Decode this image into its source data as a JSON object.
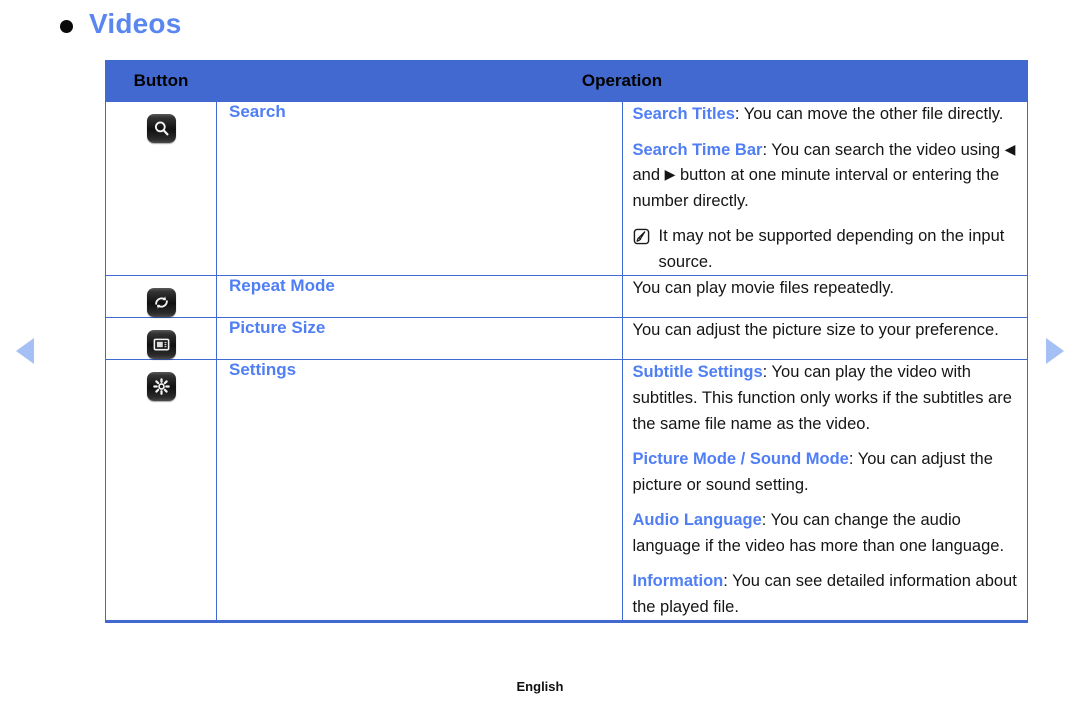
{
  "heading": {
    "bullet": "bullet-point",
    "title": "Videos"
  },
  "nav": {
    "prev_label": "previous-page",
    "next_label": "next-page"
  },
  "table": {
    "headers": {
      "button": "Button",
      "operation": "Operation"
    },
    "rows": [
      {
        "icon": "search-icon",
        "name": "Search",
        "blocks": [
          {
            "kind": "text",
            "term": "Search Titles",
            "rest": ": You can move the other file directly."
          },
          {
            "kind": "text",
            "term": "Search Time Bar",
            "rest_a": ": You can search the video using ",
            "glyph_left": "◀",
            "mid": " and ",
            "glyph_right": "▶",
            "rest_b": " button at one minute interval or entering the number directly."
          },
          {
            "kind": "note",
            "note": "It may not be supported depending on the input source."
          }
        ]
      },
      {
        "icon": "repeat-icon",
        "name": "Repeat Mode",
        "blocks": [
          {
            "kind": "plain",
            "text": "You can play movie files repeatedly."
          }
        ]
      },
      {
        "icon": "picture-size-icon",
        "name": "Picture Size",
        "blocks": [
          {
            "kind": "plain",
            "text": "You can adjust the picture size to your preference."
          }
        ]
      },
      {
        "icon": "settings-gear-icon",
        "name": "Settings",
        "blocks": [
          {
            "kind": "text",
            "term": "Subtitle Settings",
            "rest": ": You can play the video with subtitles. This function only works if the subtitles are the same file name as the video."
          },
          {
            "kind": "text",
            "term": "Picture Mode / Sound Mode",
            "rest": ": You can adjust the picture or sound setting."
          },
          {
            "kind": "text",
            "term": "Audio Language",
            "rest": ": You can change the audio language if the video has more than one language."
          },
          {
            "kind": "text",
            "term": "Information",
            "rest": ": You can see detailed information about the played file."
          }
        ]
      }
    ]
  },
  "footer": {
    "language": "English"
  },
  "colors": {
    "heading": "#5a86f0",
    "term": "#4f7ef5",
    "table_border": "#4169d0",
    "header_bg": "#4169d0",
    "nav_arrow": "#a5c0f5"
  }
}
